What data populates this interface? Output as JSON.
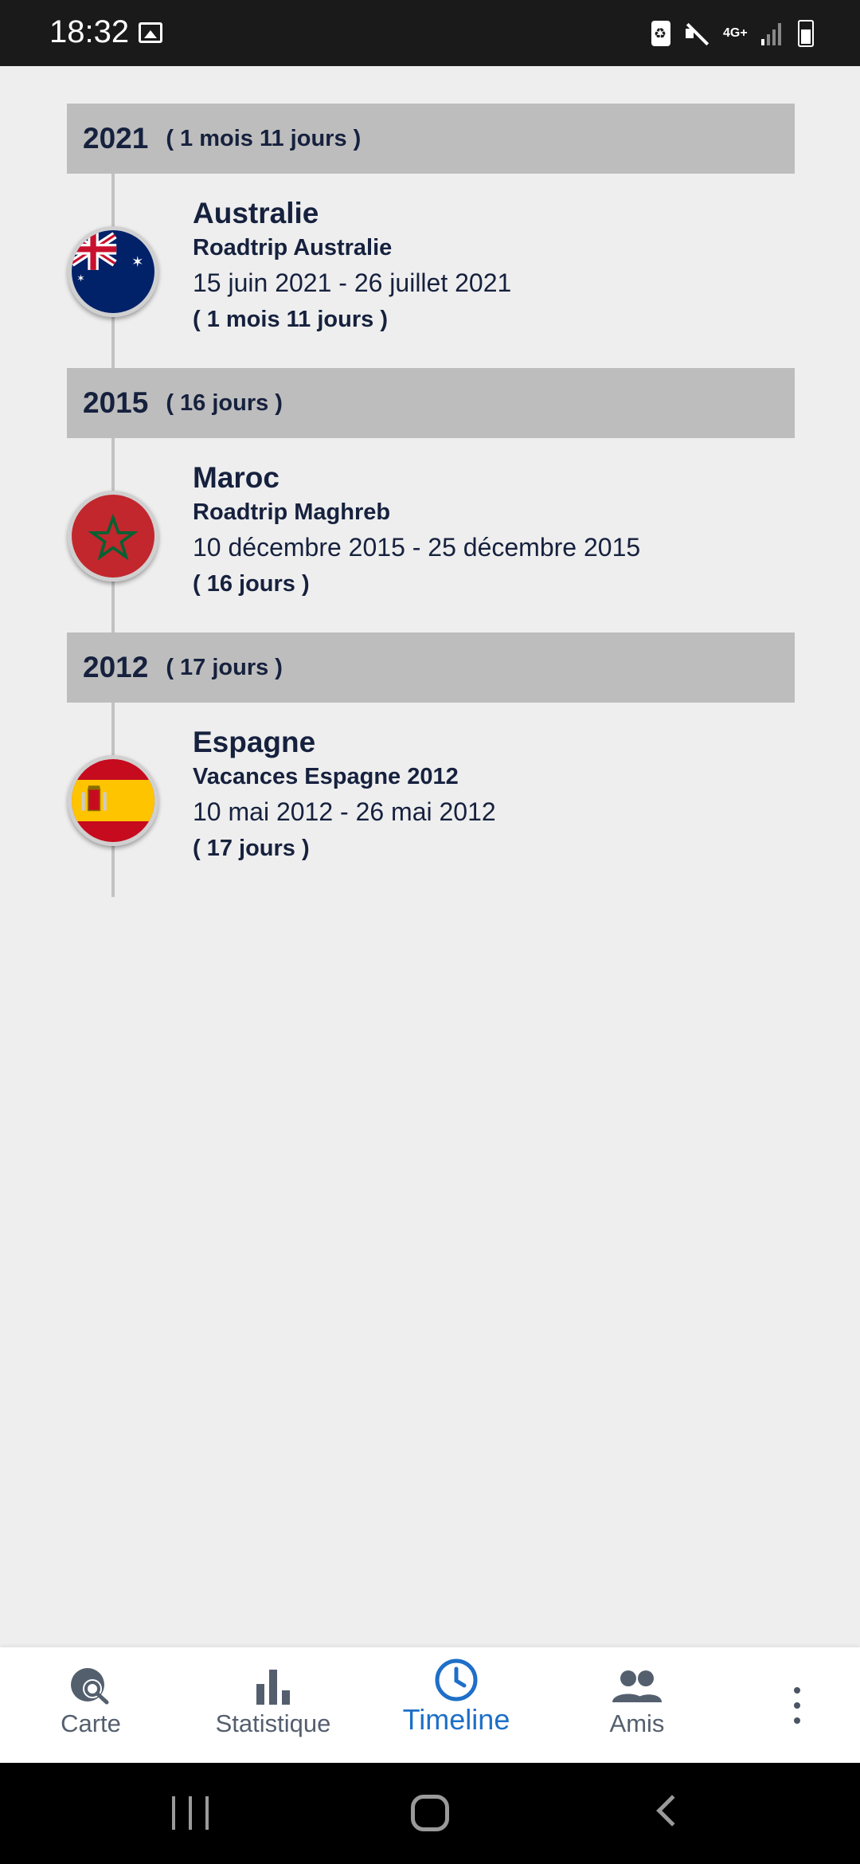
{
  "status_bar": {
    "time": "18:32",
    "network_label": "4G+",
    "icons": [
      "gallery-icon",
      "battery-saver-icon",
      "vibrate-mute-icon",
      "network-4g-icon",
      "signal-icon",
      "battery-icon"
    ]
  },
  "timeline": {
    "groups": [
      {
        "year": "2021",
        "duration": "( 1 mois 11 jours )",
        "entries": [
          {
            "country": "Australie",
            "trip": "Roadtrip Australie",
            "dates": "15 juin 2021 - 26 juillet 2021",
            "duration": "( 1 mois 11 jours )",
            "flag": "australia-flag-icon"
          }
        ]
      },
      {
        "year": "2015",
        "duration": "( 16 jours )",
        "entries": [
          {
            "country": "Maroc",
            "trip": "Roadtrip Maghreb",
            "dates": "10 décembre 2015 - 25 décembre 2015",
            "duration": "( 16 jours )",
            "flag": "morocco-flag-icon"
          }
        ]
      },
      {
        "year": "2012",
        "duration": "( 17 jours )",
        "entries": [
          {
            "country": "Espagne",
            "trip": "Vacances Espagne 2012",
            "dates": "10 mai 2012 - 26 mai 2012",
            "duration": "( 17 jours )",
            "flag": "spain-flag-icon"
          }
        ]
      }
    ]
  },
  "bottom_nav": {
    "items": [
      {
        "label": "Carte",
        "icon": "globe-search-icon",
        "active": false
      },
      {
        "label": "Statistique",
        "icon": "bar-chart-icon",
        "active": false
      },
      {
        "label": "Timeline",
        "icon": "clock-icon",
        "active": true
      },
      {
        "label": "Amis",
        "icon": "people-icon",
        "active": false
      }
    ],
    "more_icon": "more-vertical-icon"
  },
  "colors": {
    "background": "#eeeeee",
    "year_header": "#bdbdbd",
    "text": "#16213e",
    "active_nav": "#1e6fc8",
    "inactive_nav": "#545f6e"
  }
}
